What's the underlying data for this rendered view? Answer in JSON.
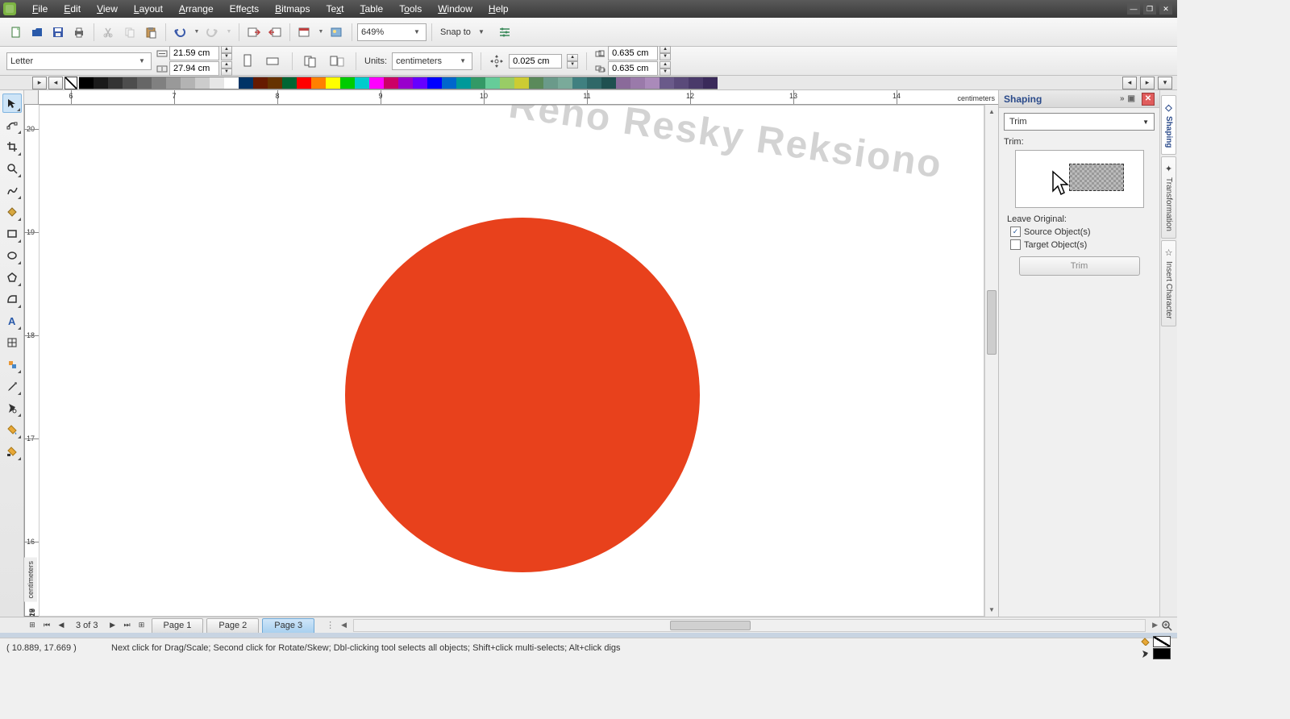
{
  "menu": {
    "items": [
      "File",
      "Edit",
      "View",
      "Layout",
      "Arrange",
      "Effects",
      "Bitmaps",
      "Text",
      "Table",
      "Tools",
      "Window",
      "Help"
    ]
  },
  "toolbar1": {
    "zoom": "649%",
    "snap_label": "Snap to"
  },
  "propbar": {
    "page_preset": "Letter",
    "width": "21.59 cm",
    "height": "27.94 cm",
    "units_label": "Units:",
    "units_value": "centimeters",
    "nudge": "0.025 cm",
    "dup_x": "0.635 cm",
    "dup_y": "0.635 cm"
  },
  "ruler": {
    "h_numbers": [
      "6",
      "7",
      "8",
      "9",
      "10",
      "11",
      "12",
      "13",
      "14"
    ],
    "v_numbers": [
      "20",
      "19",
      "18",
      "17",
      "16"
    ],
    "unit_label": "centimeters"
  },
  "pagenav": {
    "info": "3 of 3",
    "tabs": [
      "Page 1",
      "Page 2",
      "Page 3"
    ],
    "active_index": 2
  },
  "docker": {
    "title": "Shaping",
    "mode": "Trim",
    "section_label": "Trim:",
    "leave_original_label": "Leave Original:",
    "source_label": "Source Object(s)",
    "target_label": "Target Object(s)",
    "source_checked": true,
    "target_checked": false,
    "apply_label": "Trim"
  },
  "side_tabs": [
    "Shaping",
    "Transformation",
    "Insert Character"
  ],
  "status": {
    "coords": "( 10.889, 17.669 )",
    "hint": "Next click for Drag/Scale; Second click for Rotate/Skew; Dbl-clicking tool selects all objects; Shift+click multi-selects; Alt+click digs"
  },
  "watermark": "Reno Resky Reksiono",
  "colors": {
    "palette": [
      "#000000",
      "#1a1a1a",
      "#333333",
      "#4d4d4d",
      "#666666",
      "#808080",
      "#999999",
      "#b3b3b3",
      "#cccccc",
      "#e6e6e6",
      "#ffffff",
      "#003366",
      "#661a00",
      "#663300",
      "#006633",
      "#ff0000",
      "#ff8000",
      "#ffff00",
      "#00cc00",
      "#00cccc",
      "#ff00ff",
      "#cc0066",
      "#9900cc",
      "#6600ff",
      "#0000ff",
      "#0066cc",
      "#009999",
      "#339966",
      "#66cc99",
      "#99cc66",
      "#cccc33",
      "#5a8a5a",
      "#6a9a8a",
      "#7aaa9a",
      "#408080",
      "#306868",
      "#205050",
      "#8a6a9a",
      "#9a7aaa",
      "#aa8aba",
      "#6a5a8a",
      "#5a4a7a",
      "#4a3a6a",
      "#3a2a5a"
    ],
    "fill": "#e8411c",
    "outline_none": true
  }
}
